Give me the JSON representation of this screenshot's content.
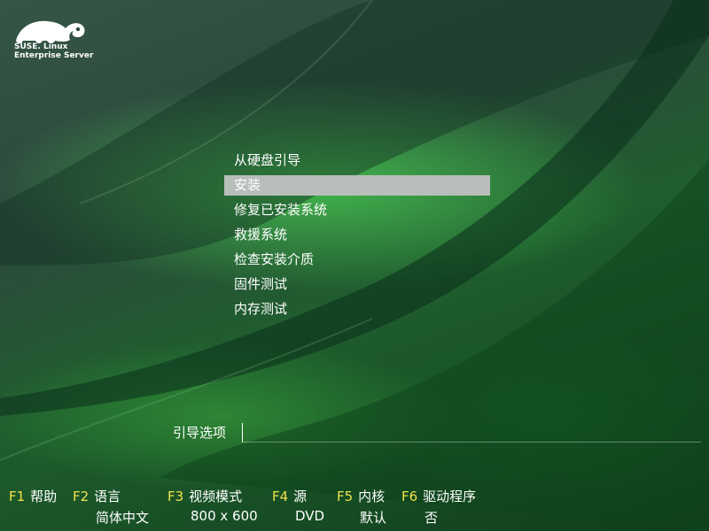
{
  "brand": {
    "logo_icon": "chameleon-logo-icon",
    "line1": "SUSE. Linux",
    "line2": "Enterprise Server"
  },
  "boot_menu": {
    "selected_index": 1,
    "items": [
      {
        "label": "从硬盘引导"
      },
      {
        "label": "安装"
      },
      {
        "label": "修复已安装系统"
      },
      {
        "label": "救援系统"
      },
      {
        "label": "检查安装介质"
      },
      {
        "label": "固件测试"
      },
      {
        "label": "内存测试"
      }
    ]
  },
  "boot_options": {
    "label": "引导选项",
    "value": "",
    "placeholder": ""
  },
  "function_keys": [
    {
      "key": "F1",
      "label": "帮助",
      "value": ""
    },
    {
      "key": "F2",
      "label": "语言",
      "value": "简体中文"
    },
    {
      "key": "F3",
      "label": "视频模式",
      "value": "800 x 600"
    },
    {
      "key": "F4",
      "label": "源",
      "value": "DVD"
    },
    {
      "key": "F5",
      "label": "内核",
      "value": "默认"
    },
    {
      "key": "F6",
      "label": "驱动程序",
      "value": "否"
    }
  ],
  "colors": {
    "fkey_accent": "#f1e24a",
    "selection_bar": "#b8beba",
    "background_green": "#2c4a3c"
  }
}
